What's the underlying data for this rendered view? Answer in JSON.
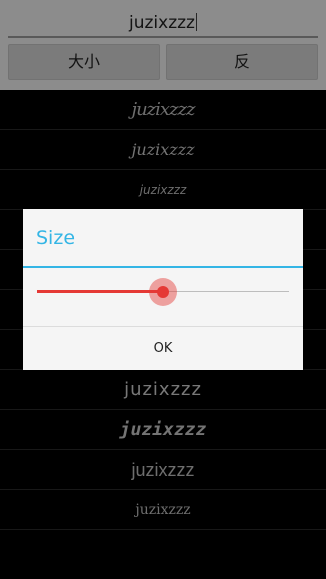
{
  "input": {
    "value": "juzixzzz"
  },
  "buttons": {
    "size_label": "大小",
    "reverse_label": "反"
  },
  "list": {
    "items": [
      "juzixzzz",
      "juzixzzz",
      "juzixzzz",
      "juzixzzz",
      "juzixzzz",
      "juzixzzz",
      "juzixzzz",
      "juzixzzz",
      "juzixzzz",
      "juzixzzz",
      "juzixzzz"
    ]
  },
  "dialog": {
    "title": "Size",
    "slider_value": 0.5,
    "ok_label": "OK",
    "accent_color": "#33b5e5",
    "slider_color": "#e53935"
  }
}
